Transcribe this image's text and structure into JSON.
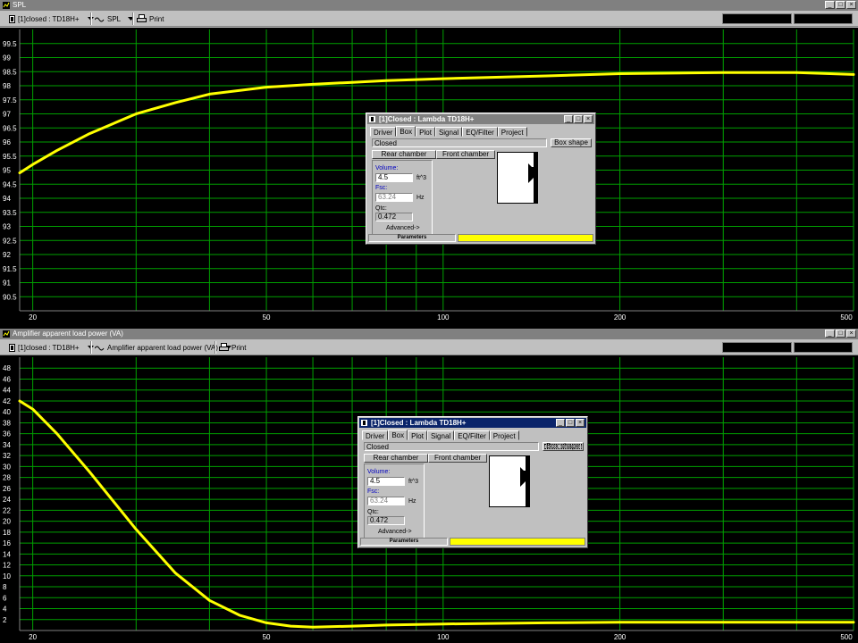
{
  "top_window": {
    "title": "SPL",
    "buttons": [
      "_",
      "□",
      "×"
    ],
    "toolbar": {
      "project_select": "[1]closed : TD18H+",
      "graph_select": "SPL",
      "print_label": "Print"
    }
  },
  "bottom_window": {
    "title": "Amplifier apparent load power (VA)",
    "buttons": [
      "_",
      "□",
      "×"
    ],
    "toolbar": {
      "project_select": "[1]closed : TD18H+",
      "graph_select": "Amplifier apparent load power (VA)",
      "print_label": "Print"
    }
  },
  "dialog_top": {
    "title": "[1]Closed : Lambda TD18H+",
    "tabs": [
      "Driver",
      "Box",
      "Plot",
      "Signal",
      "EQ/Filter",
      "Project"
    ],
    "selected_tab": "Box",
    "box_type": "Closed",
    "box_shape_label": "Box shape",
    "rear_chamber_label": "Rear chamber",
    "front_chamber_label": "Front chamber",
    "volume_label": "Volume:",
    "volume_value": "4.5",
    "volume_unit": "ft^3",
    "fsc_label": "Fsc:",
    "fsc_value": "63.24",
    "fsc_unit": "Hz",
    "qtc_label": "Qtc:",
    "qtc_value": "0.472",
    "advanced_label": "Advanced->",
    "status_label": "Parameters"
  },
  "dialog_bottom": {
    "title": "[1]Closed : Lambda TD18H+",
    "tabs": [
      "Driver",
      "Box",
      "Plot",
      "Signal",
      "EQ/Filter",
      "Project"
    ],
    "selected_tab": "Box",
    "box_type": "Closed",
    "box_shape_label": "Box shape",
    "rear_chamber_label": "Rear chamber",
    "front_chamber_label": "Front chamber",
    "volume_label": "Volume:",
    "volume_value": "4.5",
    "volume_unit": "ft^3",
    "fsc_label": "Fsc:",
    "fsc_value": "63.24",
    "fsc_unit": "Hz",
    "qtc_label": "Qtc:",
    "qtc_value": "0.472",
    "advanced_label": "Advanced->",
    "status_label": "Parameters"
  },
  "colors": {
    "plot_bg": "#000000",
    "grid": "#00a000",
    "curve": "#ffff00",
    "window_face": "#c0c0c0",
    "active_title": "#0a246a",
    "inactive_title": "#808080"
  },
  "icons": {
    "project": "document-icon",
    "graph": "wave-icon",
    "print": "printer-icon",
    "dropdown": "triangle-down-icon"
  },
  "chart_data": [
    {
      "type": "line",
      "x_scale": "log",
      "xlim": [
        19,
        500
      ],
      "ylim": [
        90,
        100
      ],
      "x_ticks": [
        20,
        50,
        100,
        200,
        500
      ],
      "y_ticks": [
        90.5,
        91,
        91.5,
        92,
        92.5,
        93,
        93.5,
        94,
        94.5,
        95,
        95.5,
        96,
        96.5,
        97,
        97.5,
        98,
        98.5,
        99,
        99.5
      ],
      "x_grid_lines": [
        20,
        30,
        40,
        50,
        60,
        70,
        80,
        90,
        100,
        200,
        300,
        400,
        500
      ],
      "grid": true,
      "series": [
        {
          "x": [
            19,
            20,
            22,
            25,
            30,
            35,
            40,
            50,
            60,
            70,
            80,
            100,
            150,
            200,
            300,
            400,
            500
          ],
          "values": [
            94.9,
            95.2,
            95.7,
            96.3,
            97.0,
            97.4,
            97.7,
            97.95,
            98.05,
            98.12,
            98.18,
            98.25,
            98.35,
            98.43,
            98.47,
            98.47,
            98.4
          ]
        }
      ]
    },
    {
      "type": "line",
      "x_scale": "log",
      "xlim": [
        19,
        500
      ],
      "ylim": [
        0,
        50
      ],
      "x_ticks": [
        20,
        50,
        100,
        200,
        500
      ],
      "y_ticks": [
        2,
        4,
        6,
        8,
        10,
        12,
        14,
        16,
        18,
        20,
        22,
        24,
        26,
        28,
        30,
        32,
        34,
        36,
        38,
        40,
        42,
        44,
        46,
        48
      ],
      "x_grid_lines": [
        20,
        30,
        40,
        50,
        60,
        70,
        80,
        90,
        100,
        200,
        300,
        400,
        500
      ],
      "grid": true,
      "series": [
        {
          "x": [
            19,
            20,
            22,
            25,
            30,
            35,
            40,
            45,
            50,
            55,
            60,
            70,
            80,
            100,
            150,
            200,
            300,
            500
          ],
          "values": [
            42,
            40.5,
            36,
            29,
            18.5,
            10.5,
            5.5,
            2.8,
            1.4,
            0.8,
            0.6,
            0.8,
            1.0,
            1.2,
            1.4,
            1.5,
            1.5,
            1.5
          ]
        }
      ]
    }
  ]
}
